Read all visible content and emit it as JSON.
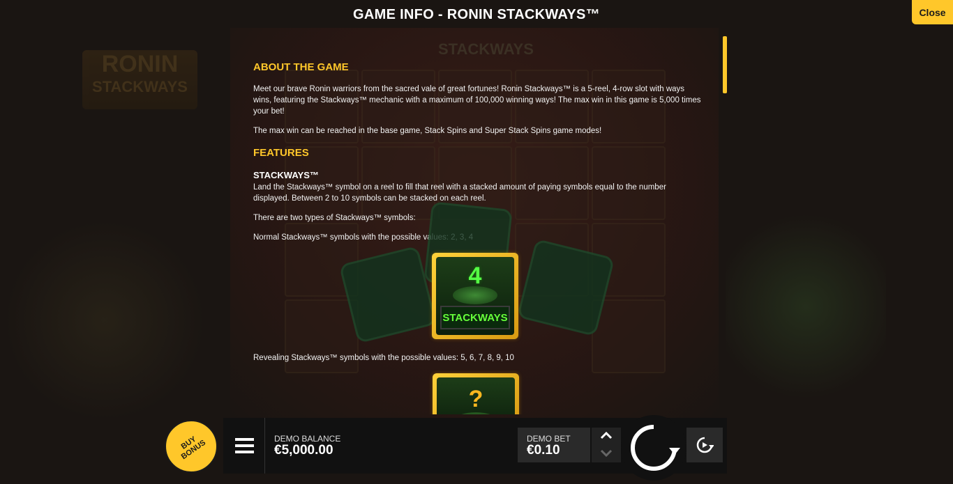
{
  "window": {
    "top_text": "",
    "title": "GAME INFO - RONIN STACKWAYS™"
  },
  "header": {
    "close_label": "Close"
  },
  "background": {
    "logo_line1": "RONIN",
    "logo_line2": "STACKWAYS",
    "reel_title": "STACKWAYS"
  },
  "info": {
    "about_title": "ABOUT THE GAME",
    "about_p1": "Meet our brave Ronin warriors from the sacred vale of great fortunes! Ronin Stackways™ is a 5-reel, 4-row slot with ways wins, featuring the Stackways™ mechanic with a maximum of 100,000 winning ways! The max win in this game is 5,000 times your bet!",
    "about_p2": "The max win can be reached in the base game, Stack Spins and Super Stack Spins game modes!",
    "features_title": "FEATURES",
    "stackways_title": "STACKWAYS™",
    "stackways_p1": "Land the Stackways™ symbol on a reel to fill that reel with a stacked amount of paying symbols equal to the number displayed. Between 2 to 10 symbols can be stacked on each reel.",
    "stackways_p2": "There are two types of Stackways™ symbols:",
    "stackways_p3": "Normal Stackways™ symbols with the possible values: 2, 3, 4",
    "symbol1_number": "4",
    "symbol1_label": "STACKWAYS",
    "stackways_p4": "Revealing Stackways™ symbols with the possible values: 5, 6, 7, 8, 9, 10",
    "symbol2_number": "?",
    "scroll_position": 0.0
  },
  "bottom_bar": {
    "buy_bonus_label": "BUY BONUS",
    "balance_label": "DEMO BALANCE",
    "balance_value": "€5,000.00",
    "bet_label": "DEMO BET",
    "bet_value": "€0.10"
  },
  "icons": {
    "menu": "hamburger-menu-icon",
    "bet_up": "chevron-up-icon",
    "bet_down": "chevron-down-icon",
    "spin": "spin-arrow-icon",
    "autoplay": "autoplay-icon"
  },
  "colors": {
    "accent": "#ffc72a",
    "panel_text": "#f2f2f2",
    "bar_bg": "#111111"
  }
}
